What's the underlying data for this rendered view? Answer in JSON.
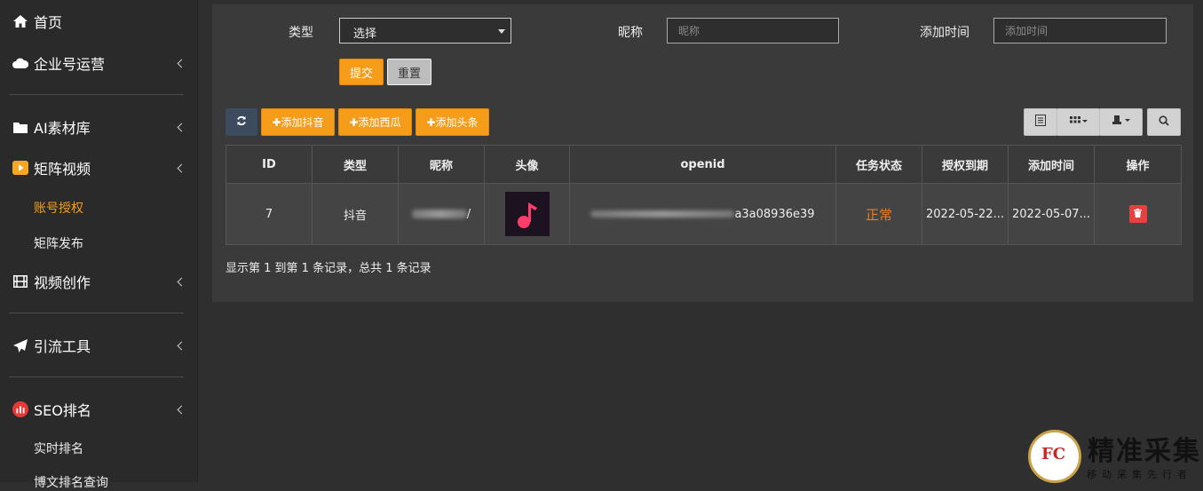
{
  "sidebar": {
    "items": [
      {
        "label": "首页",
        "icon": "home-icon"
      },
      {
        "label": "企业号运营",
        "icon": "cloud-icon"
      },
      {
        "label": "AI素材库",
        "icon": "folder-icon"
      },
      {
        "label": "矩阵视频",
        "icon": "play-icon"
      },
      {
        "label": "视频创作",
        "icon": "film-icon"
      },
      {
        "label": "引流工具",
        "icon": "paper-plane-icon"
      },
      {
        "label": "SEO排名",
        "icon": "bar-chart-icon"
      }
    ],
    "sub_items": {
      "matrix_video": [
        "账号授权",
        "矩阵发布"
      ],
      "seo": [
        "实时排名",
        "博文排名查询"
      ]
    }
  },
  "filter": {
    "type_label": "类型",
    "type_value": "选择",
    "nickname_label": "昵称",
    "nickname_placeholder": "昵称",
    "add_time_label": "添加时间",
    "add_time_placeholder": "添加时间",
    "submit_label": "提交",
    "reset_label": "重置"
  },
  "toolbar": {
    "add_douyin": "✚添加抖音",
    "add_xigua": "✚添加西瓜",
    "add_toutiao": "✚添加头条"
  },
  "table": {
    "headers": [
      "ID",
      "类型",
      "昵称",
      "头像",
      "openid",
      "任务状态",
      "授权到期",
      "添加时间",
      "操作"
    ],
    "rows": [
      {
        "id": "7",
        "type": "抖音",
        "nickname_suffix": "/",
        "openid_suffix": "a3a08936e39",
        "status": "正常",
        "auth_expire": "2022-05-22...",
        "add_time": "2022-05-07..."
      }
    ]
  },
  "pagination": {
    "summary": "显示第 1 到第 1 条记录，总共 1 条记录"
  },
  "watermark": {
    "logo_text": "FC",
    "title": "精准采集",
    "subtitle": "移动采集先行者"
  },
  "colors": {
    "accent": "#f59c1a",
    "status_normal": "#f07c1a",
    "delete": "#e64141",
    "active_nav": "#f0a020"
  }
}
